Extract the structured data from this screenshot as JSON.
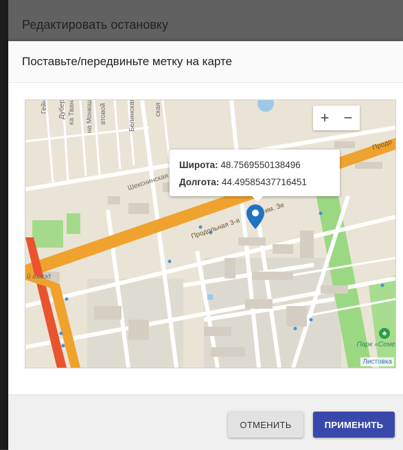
{
  "dialog": {
    "title": "Редактировать остановку",
    "subtitle": "Поставьте/передвиньте метку на карте"
  },
  "map": {
    "zoom_in": "+",
    "zoom_out": "−",
    "popup": {
      "lat_label": "Широта:",
      "lat_value": "48.7569550138496",
      "lng_label": "Долгота:",
      "lng_value": "44.49585437716451"
    },
    "attribution": "Листовка",
    "park_label": "Парк «Семе",
    "streets": {
      "prodolnaya": "Продольная 3-я",
      "sheksninskaya": "Шекснинская",
      "im_ze": "им. Зе",
      "prodo": "Продо",
      "geine": "Гейне",
      "dubertha": "Дуберта",
      "tvana": "ка Твана",
      "monyushko": "на Монюшко",
      "atovoy": "атовой",
      "belinskaya": "Белинская",
      "skaya": "ская",
      "vyezd": "й въезд"
    },
    "icons": {
      "marker": "location-pin-icon",
      "park": "park-icon"
    }
  },
  "footer": {
    "cancel_label": "ОТМЕНИТЬ",
    "apply_label": "ПРИМЕНИТЬ"
  },
  "colors": {
    "header_bg": "#616161",
    "apply_bg": "#3949ab",
    "marker": "#1f73c4",
    "main_road": "#f0a22e",
    "park": "#8fd179"
  }
}
